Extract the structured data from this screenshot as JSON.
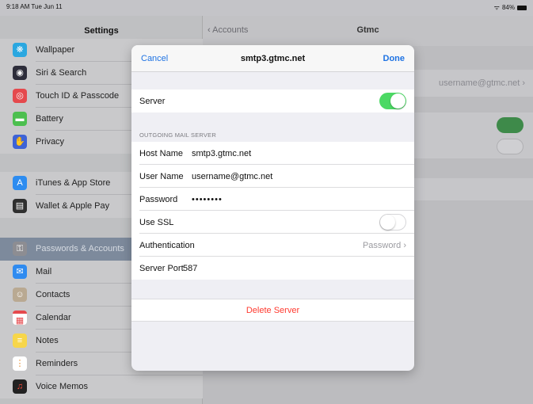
{
  "status_bar": {
    "time": "9:18 AM  Tue Jun 11",
    "battery": "84%"
  },
  "sidebar": {
    "title": "Settings",
    "items": [
      {
        "label": "Wallpaper",
        "icon": "wallpaper-icon",
        "color": "#2aa7e0",
        "glyph": "❋"
      },
      {
        "label": "Siri & Search",
        "icon": "siri-icon",
        "color": "#2d2d3a",
        "glyph": "◉"
      },
      {
        "label": "Touch ID & Passcode",
        "icon": "fingerprint-icon",
        "color": "#e5494d",
        "glyph": "◎"
      },
      {
        "label": "Battery",
        "icon": "battery-icon",
        "color": "#4cbf4f",
        "glyph": "▬"
      },
      {
        "label": "Privacy",
        "icon": "hand-icon",
        "color": "#3e63d6",
        "glyph": "✋"
      },
      {
        "label": "iTunes & App Store",
        "icon": "app-store-icon",
        "color": "#2d8cf0",
        "glyph": "A"
      },
      {
        "label": "Wallet & Apple Pay",
        "icon": "wallet-icon",
        "color": "#2f2f2f",
        "glyph": "▤"
      },
      {
        "label": "Passwords & Accounts",
        "icon": "key-icon",
        "color": "#8d8d92",
        "glyph": "⚿",
        "selected": true
      },
      {
        "label": "Mail",
        "icon": "mail-icon",
        "color": "#2f8bf0",
        "glyph": "✉"
      },
      {
        "label": "Contacts",
        "icon": "contacts-icon",
        "color": "#b9a992",
        "glyph": "☺"
      },
      {
        "label": "Calendar",
        "icon": "calendar-icon",
        "color": "#ffffff",
        "glyph": "▦"
      },
      {
        "label": "Notes",
        "icon": "notes-icon",
        "color": "#f7d64a",
        "glyph": "≡"
      },
      {
        "label": "Reminders",
        "icon": "reminders-icon",
        "color": "#ffffff",
        "glyph": "⋮"
      },
      {
        "label": "Voice Memos",
        "icon": "voice-memos-icon",
        "color": "#222222",
        "glyph": "♫"
      }
    ]
  },
  "detail": {
    "back_label": "Accounts",
    "title": "Gtmc",
    "account_value": "username@gtmc.net"
  },
  "modal": {
    "cancel_label": "Cancel",
    "title": "smtp3.gtmc.net",
    "done_label": "Done",
    "server_label": "Server",
    "server_on": true,
    "section_header": "OUTGOING MAIL SERVER",
    "host_label": "Host Name",
    "host_value": "smtp3.gtmc.net",
    "user_label": "User Name",
    "user_value": "username@gtmc.net",
    "password_label": "Password",
    "password_value": "••••••••",
    "ssl_label": "Use SSL",
    "ssl_on": false,
    "auth_label": "Authentication",
    "auth_value": "Password",
    "port_label": "Server Port",
    "port_value": "587",
    "delete_label": "Delete Server"
  },
  "colors": {
    "accent": "#1f73e3",
    "toggle_on": "#4cd964",
    "destructive": "#ff3b30"
  }
}
